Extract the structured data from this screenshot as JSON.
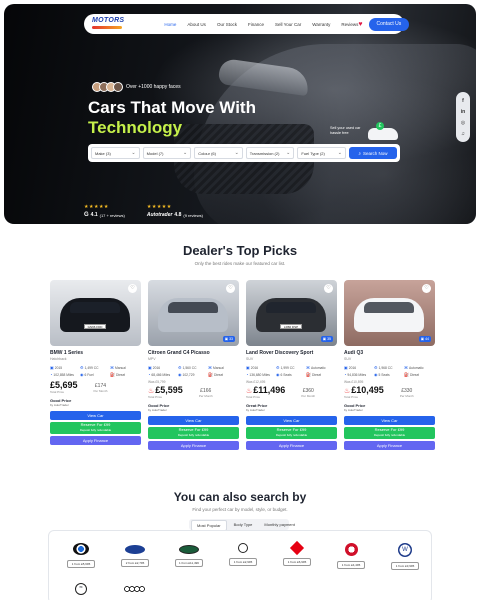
{
  "nav": {
    "logo": "MOTORS",
    "links": [
      "Home",
      "About Us",
      "Our Stock",
      "Finance",
      "Sell Your Car",
      "Warranty",
      "Reviews"
    ],
    "contact_label": "Contact Us"
  },
  "hero": {
    "happy_faces": "Over +1000 happy faces",
    "title_line1": "Cars That Move With",
    "title_line2": "Technology",
    "sell_text": "Sell your used car hassle free",
    "search": {
      "make": "Make (3)",
      "model": "Model (7)",
      "colour": "Colour (6)",
      "transmission": "Transmission (2)",
      "fuel": "Fuel Type (2)",
      "button": "Search Now"
    },
    "ratings": [
      {
        "stars": "★★★★★",
        "brand": "G",
        "score": "4.1",
        "reviews": "(17 + reviews)"
      },
      {
        "stars": "★★★★★",
        "brand": "Autotrader",
        "score": "4.8",
        "reviews": "(9 reviews)"
      }
    ]
  },
  "social": [
    "f",
    "in",
    "◎",
    "♫"
  ],
  "top_picks": {
    "title": "Dealer's Top Picks",
    "subtitle": "Only the best rides make our featured car list.",
    "cards": [
      {
        "title": "BMW 1 Series",
        "sub": "Hatchback",
        "photos": "",
        "specs": [
          "2015",
          "1,499 CC",
          "Manual",
          "102,858 Miles",
          "6 Fuel",
          "Diesel"
        ],
        "was": "",
        "price": "£5,695",
        "price_label": "Total Price",
        "monthly": "£174",
        "monthly_label": "Per Month",
        "badge": "Good Price",
        "badge_src": "by AutoTrader",
        "view": "View Car",
        "reserve": "Reserve For £99",
        "reserve_sub": "Deposit fully refundable",
        "finance": "Apply Finance"
      },
      {
        "title": "Citroen Grand C4 Picasso",
        "sub": "MPV",
        "photos": "33",
        "specs": [
          "2016",
          "1,560 CC",
          "Manual",
          "68,466 Miles",
          "102,729",
          "Diesel"
        ],
        "was": "Was £5,799",
        "price": "£5,595",
        "price_label": "Total Price",
        "monthly": "£166",
        "monthly_label": "Per Month",
        "badge": "Good Price",
        "badge_src": "by AutoTrader",
        "view": "View Car",
        "reserve": "Reserve For £99",
        "reserve_sub": "Deposit fully refundable",
        "finance": "Apply Finance"
      },
      {
        "title": "Land Rover Discovery Sport",
        "sub": "SUV",
        "photos": "35",
        "specs": [
          "2016",
          "1,999 CC",
          "Automatic",
          "136,680 Miles",
          "6 Seats",
          "Diesel"
        ],
        "was": "Was £12,495",
        "price": "£11,496",
        "price_label": "Total Price",
        "monthly": "£360",
        "monthly_label": "Per Month",
        "badge": "Great Price",
        "badge_src": "by AutoTrader",
        "view": "View Car",
        "reserve": "Reserve For £99",
        "reserve_sub": "Deposit fully refundable",
        "finance": "Apply Finance"
      },
      {
        "title": "Audi Q3",
        "sub": "SUV",
        "photos": "44",
        "specs": [
          "2016",
          "1,968 CC",
          "Automatic",
          "94,836 Miles",
          "5 Seats",
          "Diesel"
        ],
        "was": "Was £10,895",
        "price": "£10,495",
        "price_label": "Total Price",
        "monthly": "£330",
        "monthly_label": "Per Month",
        "badge": "Good Price",
        "badge_src": "by AutoTrader",
        "view": "View Car",
        "reserve": "Reserve For £99",
        "reserve_sub": "Deposit fully refundable",
        "finance": "Apply Finance"
      }
    ]
  },
  "search_by": {
    "title": "You can also search by",
    "subtitle": "Find your perfect car by model, style, or budget.",
    "tabs": [
      "Most Popular",
      "Body Type",
      "Monthly payment"
    ],
    "brands": [
      {
        "name": "BMW",
        "count": "1 from £5,695"
      },
      {
        "name": "Ford",
        "count": "2 from £2,795"
      },
      {
        "name": "Land Rover",
        "count": "1 from £11,496"
      },
      {
        "name": "Mini",
        "count": "1 from £2,995"
      },
      {
        "name": "Mitsubishi",
        "count": "1 from £6,995"
      },
      {
        "name": "Vauxhall",
        "count": "1 from £4,495"
      },
      {
        "name": "Volkswagen",
        "count": "1 from £3,995"
      },
      {
        "name": "Citroen",
        "count": ""
      },
      {
        "name": "Audi",
        "count": ""
      }
    ]
  }
}
